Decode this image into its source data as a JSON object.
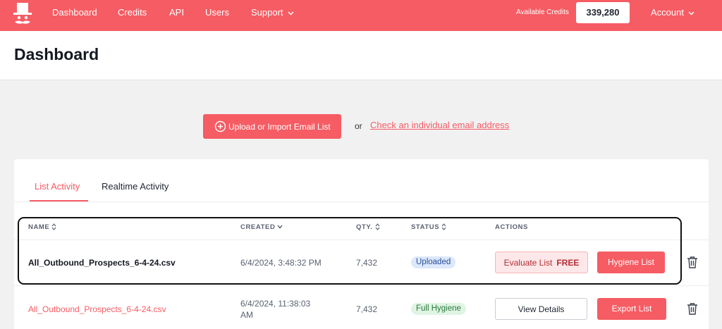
{
  "nav": {
    "items": [
      "Dashboard",
      "Credits",
      "API",
      "Users",
      "Support"
    ],
    "available_credits_label": "Available Credits",
    "available_credits_value": "339,280",
    "account_label": "Account"
  },
  "header": {
    "title": "Dashboard"
  },
  "upload": {
    "button_label": "Upload or Import Email List",
    "or_text": "or",
    "check_link": "Check an individual email address"
  },
  "tabs": [
    "List Activity",
    "Realtime Activity"
  ],
  "table": {
    "columns": [
      "NAME",
      "CREATED",
      "QTY.",
      "STATUS",
      "ACTIONS"
    ],
    "rows": [
      {
        "name": "All_Outbound_Prospects_6-4-24.csv",
        "created": "6/4/2024, 3:48:32 PM",
        "qty": "7,432",
        "status": "Uploaded",
        "action1": "Evaluate List",
        "action1_tag": "FREE",
        "action2": "Hygiene List"
      },
      {
        "name": "All_Outbound_Prospects_6-4-24.csv",
        "created_line1": "6/4/2024, 11:38:03",
        "created_line2": "AM",
        "qty": "7,432",
        "status": "Full Hygiene",
        "action1": "View Details",
        "action2": "Export List"
      }
    ]
  },
  "colors": {
    "accent": "#f65c63",
    "background": "#f1f1f2"
  }
}
